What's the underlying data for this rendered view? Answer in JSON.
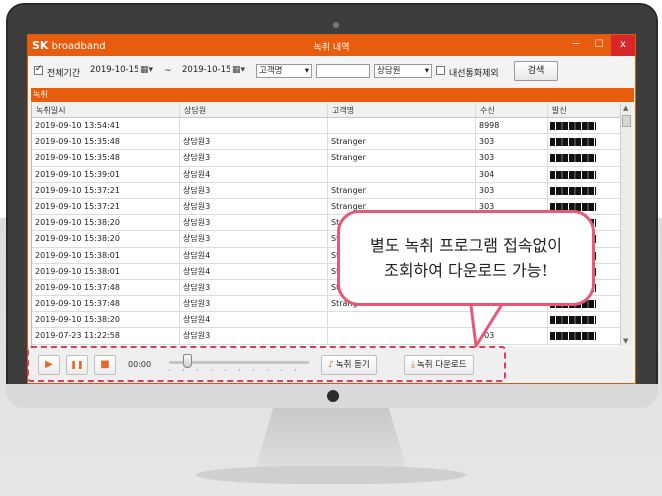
{
  "window": {
    "brand_main": "SK",
    "brand_sub": " broadband",
    "title": "녹취 내역",
    "min": "─",
    "max": "☐",
    "close": "x",
    "accent_color": "#e85c0e"
  },
  "toolbar": {
    "all_period_label": "전체기간",
    "all_period_checked": true,
    "date_from": "2019-10-15",
    "tilde": "~",
    "date_to": "2019-10-15",
    "customer_field_select": "고객명",
    "customer_input": "",
    "agent_select": "상담원",
    "exclude_internal_label": "내선통화제외",
    "exclude_internal_checked": false,
    "search_label": "검색"
  },
  "section_label": "녹취",
  "table": {
    "columns": [
      "녹취일시",
      "상담원",
      "고객명",
      "수신",
      "발신"
    ],
    "rows": [
      [
        "2019-09-10 13:54:41",
        "",
        "",
        "8998",
        ""
      ],
      [
        "2019-09-10 15:35:48",
        "상담원3",
        "Stranger",
        "303",
        ""
      ],
      [
        "2019-09-10 15:35:48",
        "상담원3",
        "Stranger",
        "303",
        ""
      ],
      [
        "2019-09-10 15:39:01",
        "상담원4",
        "",
        "304",
        ""
      ],
      [
        "2019-09-10 15:37:21",
        "상담원3",
        "Stranger",
        "303",
        ""
      ],
      [
        "2019-09-10 15:37:21",
        "상담원3",
        "Stranger",
        "303",
        ""
      ],
      [
        "2019-09-10 15:38:20",
        "상담원3",
        "Str",
        "",
        ""
      ],
      [
        "2019-09-10 15:38:20",
        "상담원3",
        "St",
        "",
        ""
      ],
      [
        "2019-09-10 15:38:01",
        "상담원4",
        "St",
        "",
        ""
      ],
      [
        "2019-09-10 15:38:01",
        "상담원4",
        "St",
        "",
        ""
      ],
      [
        "2019-09-10 15:37:48",
        "상담원3",
        "St",
        "",
        ""
      ],
      [
        "2019-09-10 15:37:48",
        "상담원3",
        "Stranger",
        "",
        ""
      ],
      [
        "2019-09-10 15:38:20",
        "상담원4",
        "",
        "",
        ""
      ],
      [
        "2019-07-23 11:22:58",
        "상담원3",
        "",
        "303",
        ""
      ]
    ]
  },
  "player": {
    "play_icon": "▶",
    "pause_icon": "❚❚",
    "stop_icon": "■",
    "time": "00:00",
    "position_fraction": 0.1,
    "listen_label": "녹취 듣기",
    "download_label": "녹취 다운로드"
  },
  "callout": {
    "line1": "별도 녹취 프로그램 접속없이",
    "line2": "조회하여 다운로드 가능!"
  }
}
